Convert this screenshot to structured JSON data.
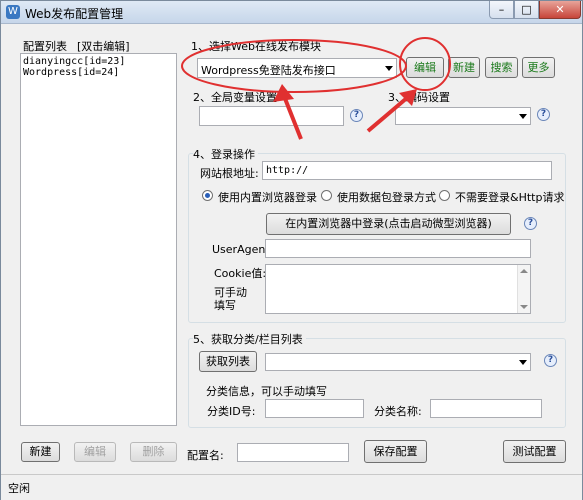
{
  "window": {
    "title": "Web发布配置管理",
    "controls": {
      "minimize": "–",
      "maximize": "□",
      "close": "✕"
    }
  },
  "config_list": {
    "label": "配置列表",
    "hint": "[双击编辑]",
    "items": [
      "dianyingcc[id=23]",
      "Wordpress[id=24]"
    ]
  },
  "module": {
    "label": "1、选择Web在线发布模块",
    "selected": "Wordpress免登陆发布接口",
    "buttons": {
      "edit": "编辑",
      "new": "新建",
      "search": "搜索",
      "more": "更多"
    }
  },
  "global_vars": {
    "label": "2、全局变量设置",
    "value": ""
  },
  "encoding": {
    "label": "3、编码设置",
    "selected": ""
  },
  "login": {
    "label": "4、登录操作",
    "root_url_label": "网站根地址:",
    "root_url_value": "http://",
    "radio_builtin": "使用内置浏览器登录",
    "radio_packet": "使用数据包登录方式",
    "radio_none": "不需要登录&Http请求",
    "login_button": "在内置浏览器中登录(点击启动微型浏览器)",
    "useragent_label": "UserAgent",
    "useragent_value": "",
    "cookie_label": "Cookie值:",
    "cookie_hint": "可手动填写",
    "cookie_value": ""
  },
  "category": {
    "label": "5、获取分类/栏目列表",
    "fetch_button": "获取列表",
    "selected": "",
    "info_label": "分类信息，可以手动填写",
    "id_label": "分类ID号:",
    "id_value": "",
    "name_label": "分类名称:",
    "name_value": ""
  },
  "footer": {
    "new_button": "新建",
    "edit_button": "编辑",
    "delete_button": "删除",
    "config_name_label": "配置名:",
    "config_name_value": "",
    "save_button": "保存配置",
    "test_button": "测试配置"
  },
  "status": {
    "text": "空闲"
  },
  "icons": {
    "help": "help-question-icon",
    "app": "app-window-icon",
    "dropdown": "chevron-down-icon"
  },
  "colors": {
    "annotation": "#e03030",
    "green_text": "#1b7a1b"
  }
}
